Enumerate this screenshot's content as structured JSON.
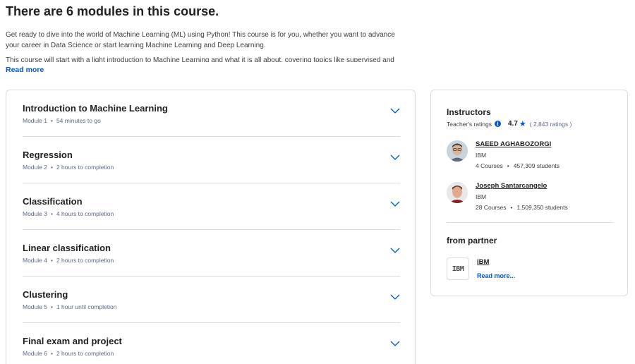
{
  "page_title": "There are 6 modules in this course.",
  "description": {
    "paragraph1": "Get ready to dive into the world of Machine Learning (ML) using Python! This course is for you, whether you want to advance your career in Data Science or start learning Machine Learning and Deep Learning.",
    "paragraph2": "This course will start with a light introduction to Machine Learning and what it is all about, covering topics like supervised and",
    "read_more": "Read more"
  },
  "modules": [
    {
      "title": "Introduction to Machine Learning",
      "number": "Module 1",
      "duration": "54 minutes to go"
    },
    {
      "title": "Regression",
      "number": "Module 2",
      "duration": "2 hours to completion"
    },
    {
      "title": "Classification",
      "number": "Module 3",
      "duration": "4 hours to completion"
    },
    {
      "title": "Linear classification",
      "number": "Module 4",
      "duration": "2 hours to completion"
    },
    {
      "title": "Clustering",
      "number": "Module 5",
      "duration": "1 hour until completion"
    },
    {
      "title": "Final exam and project",
      "number": "Module 6",
      "duration": "2 hours to completion"
    }
  ],
  "sidebar": {
    "instructors_heading": "Instructors",
    "ratings_label": "Teacher's ratings",
    "rating_value": "4.7",
    "rating_count": "( 2,843 ratings )",
    "instructors": [
      {
        "name": "SAEED AGHABOZORGI",
        "org": "IBM",
        "courses": "4 Courses",
        "students": "457,309 students"
      },
      {
        "name": "Joseph Santarcangelo",
        "org": "IBM",
        "courses": "28 Courses",
        "students": "1,509,350 students"
      }
    ],
    "partner_heading": "from partner",
    "partner_logo_text": "IBM",
    "partner_name": "IBM",
    "partner_more": "Read more..."
  },
  "colors": {
    "accent": "#0056d2",
    "border": "#dadce0",
    "meta": "#5b6780"
  },
  "icons": {
    "expand": "chevron-down-icon",
    "info": "info-icon",
    "rating": "star-icon"
  }
}
